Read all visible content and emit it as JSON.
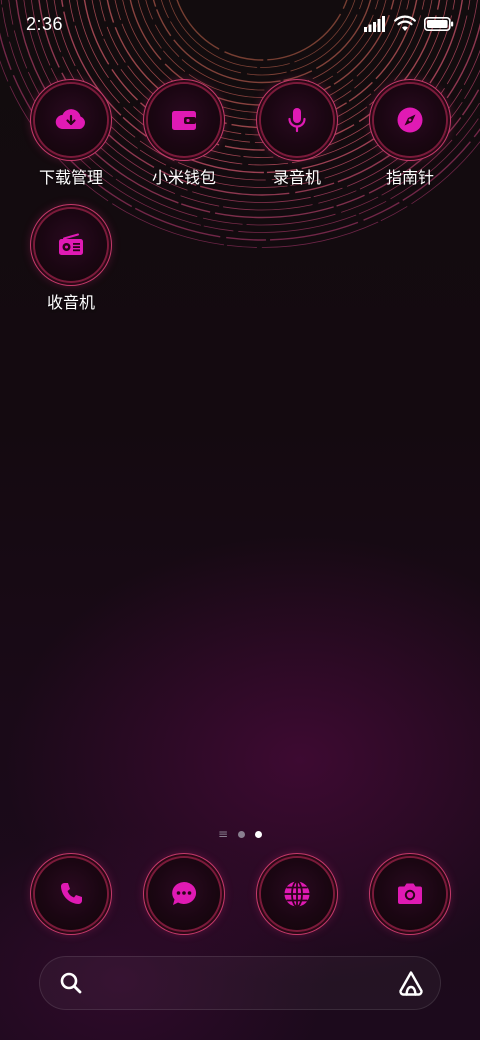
{
  "status_bar": {
    "time": "2:36",
    "icons": [
      "signal-icon",
      "wifi-icon",
      "battery-icon"
    ]
  },
  "apps": [
    {
      "label": "下载管理",
      "icon": "cloud-download-icon"
    },
    {
      "label": "小米钱包",
      "icon": "wallet-icon"
    },
    {
      "label": "录音机",
      "icon": "microphone-icon"
    },
    {
      "label": "指南针",
      "icon": "compass-icon"
    },
    {
      "label": "收音机",
      "icon": "radio-icon"
    }
  ],
  "page_indicator": {
    "pages": 2,
    "active_page": 2,
    "has_menu_page": true
  },
  "dock": [
    {
      "icon": "phone-icon"
    },
    {
      "icon": "message-icon"
    },
    {
      "icon": "browser-globe-icon"
    },
    {
      "icon": "camera-icon"
    }
  ],
  "search_bar": {
    "left_icon": "search-icon",
    "right_icon": "assistant-icon"
  },
  "colors": {
    "icon_glyph": "#e01ab4",
    "ring": "#c43a6a",
    "background": "#140a10"
  }
}
